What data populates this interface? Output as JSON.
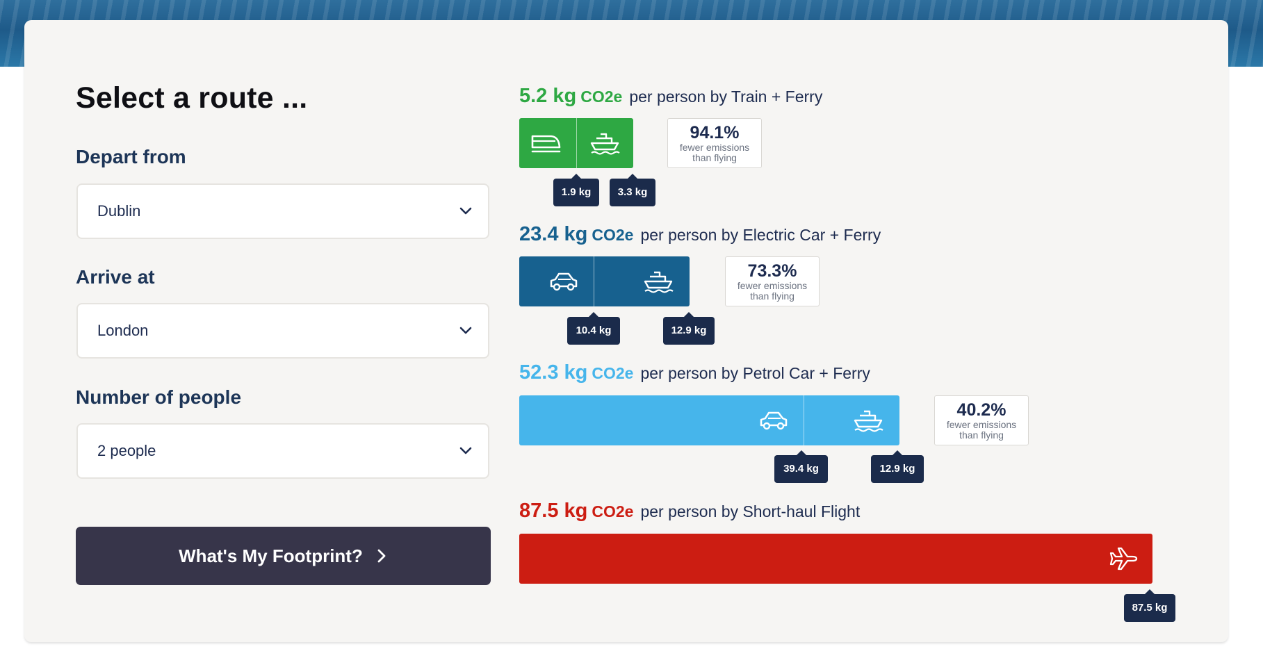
{
  "form": {
    "heading": "Select a route ...",
    "depart_label": "Depart from",
    "depart_value": "Dublin",
    "arrive_label": "Arrive at",
    "arrive_value": "London",
    "people_label": "Number of people",
    "people_value": "2 people",
    "submit_label": "What's My Footprint?"
  },
  "unit": "CO2e",
  "colors": {
    "train_ferry": "#2ea843",
    "electric_car_ferry": "#17618f",
    "petrol_car_ferry": "#46b5eb",
    "flight": "#cc1d12",
    "tooltip": "#1b2b4b",
    "button": "#37354a"
  },
  "routes": [
    {
      "total": "5.2 kg",
      "per": "per person by Train + Ferry",
      "total_value_kg": 5.2,
      "segments": [
        {
          "icon": "train-icon",
          "label": "1.9 kg",
          "value_kg": 1.9
        },
        {
          "icon": "ferry-icon",
          "label": "3.3 kg",
          "value_kg": 3.3
        }
      ],
      "savings_pct": "94.1%",
      "savings_line1": "fewer emissions",
      "savings_line2": "than flying"
    },
    {
      "total": "23.4 kg",
      "per": "per person by Electric Car + Ferry",
      "total_value_kg": 23.4,
      "segments": [
        {
          "icon": "car-icon",
          "label": "10.4 kg",
          "value_kg": 10.4
        },
        {
          "icon": "ferry-icon",
          "label": "12.9 kg",
          "value_kg": 12.9
        }
      ],
      "savings_pct": "73.3%",
      "savings_line1": "fewer emissions",
      "savings_line2": "than flying"
    },
    {
      "total": "52.3 kg",
      "per": "per person by Petrol Car + Ferry",
      "total_value_kg": 52.3,
      "segments": [
        {
          "icon": "car-icon",
          "label": "39.4 kg",
          "value_kg": 39.4
        },
        {
          "icon": "ferry-icon",
          "label": "12.9 kg",
          "value_kg": 12.9
        }
      ],
      "savings_pct": "40.2%",
      "savings_line1": "fewer emissions",
      "savings_line2": "than flying"
    },
    {
      "total": "87.5 kg",
      "per": "per person by Short-haul Flight",
      "total_value_kg": 87.5,
      "segments": [
        {
          "icon": "plane-icon",
          "label": "87.5 kg",
          "value_kg": 87.5
        }
      ]
    }
  ]
}
